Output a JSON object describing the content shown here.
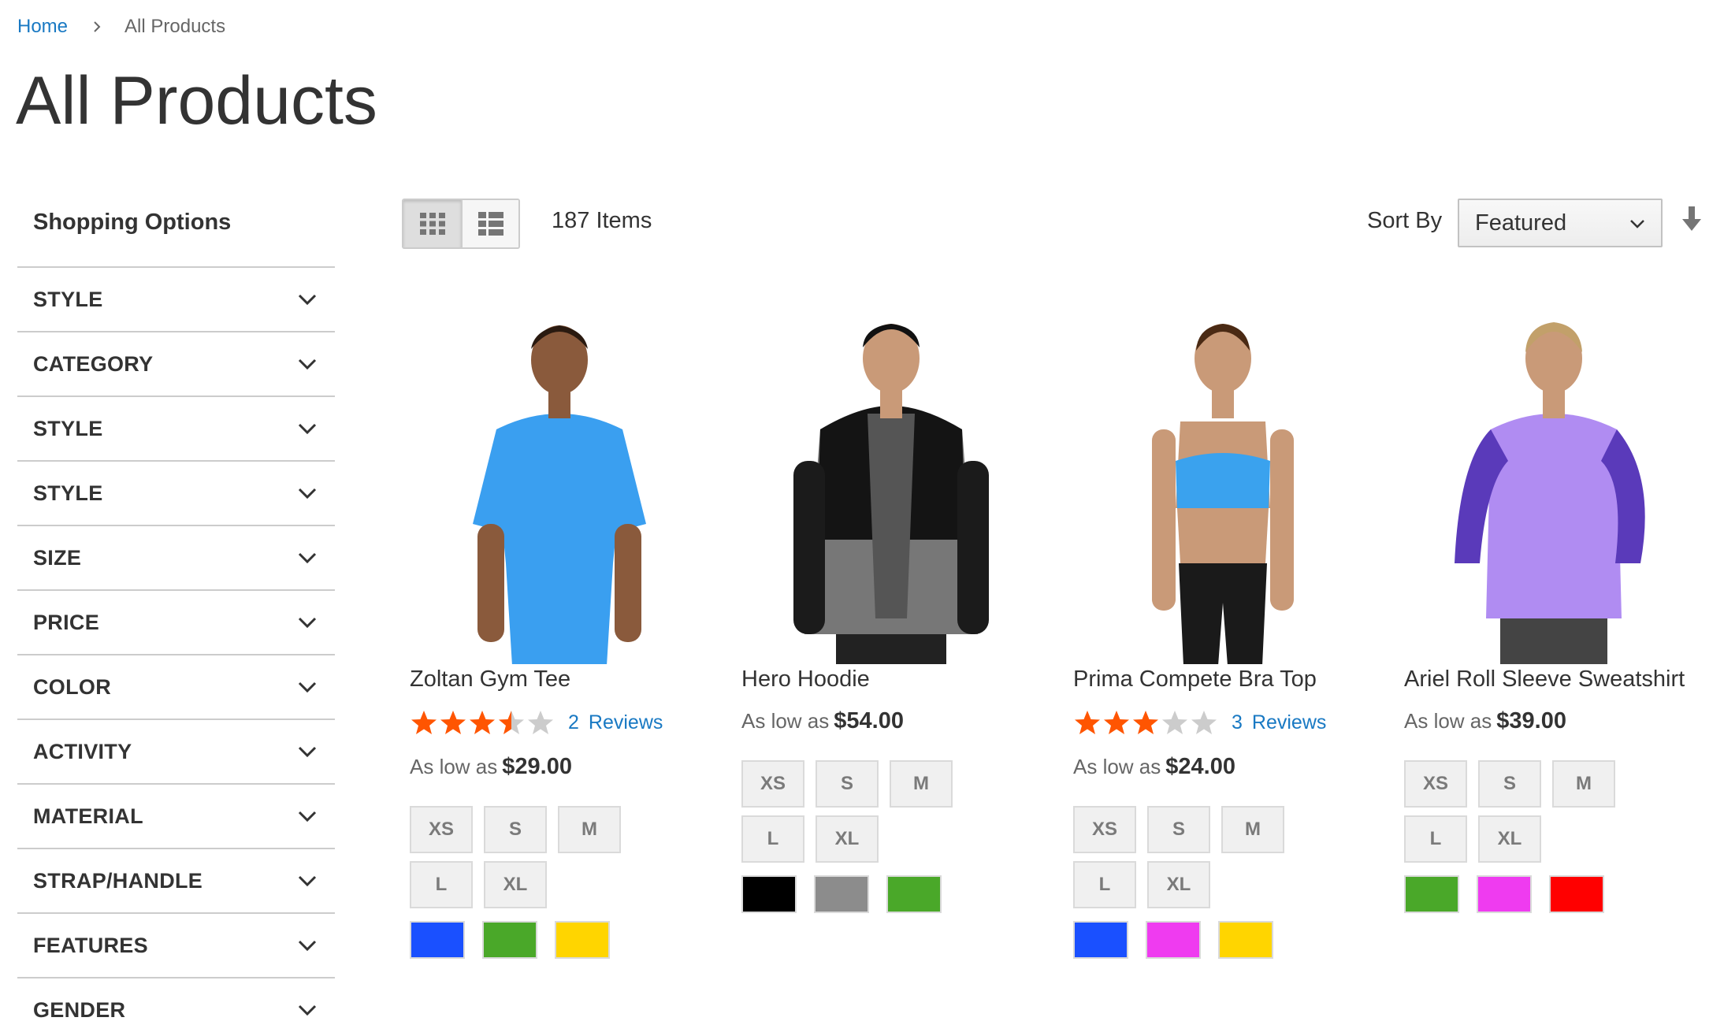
{
  "breadcrumb": {
    "home": "Home",
    "current": "All Products"
  },
  "page": {
    "title": "All Products"
  },
  "sidebar": {
    "title": "Shopping Options",
    "filters": [
      "STYLE",
      "CATEGORY",
      "STYLE",
      "STYLE",
      "SIZE",
      "PRICE",
      "COLOR",
      "ACTIVITY",
      "MATERIAL",
      "STRAP/HANDLE",
      "FEATURES",
      "GENDER"
    ]
  },
  "toolbar": {
    "view_modes": [
      "grid",
      "list"
    ],
    "active_mode": "grid",
    "items_count": "187 Items",
    "sort_label": "Sort By",
    "sort_value": "Featured",
    "sort_direction_icon": "arrow-down-icon"
  },
  "products": [
    {
      "name": "Zoltan Gym Tee",
      "rating": 3.5,
      "review_count": "2",
      "review_label": "Reviews",
      "price_prefix": "As low as",
      "price": "$29.00",
      "sizes": [
        "XS",
        "S",
        "M",
        "L",
        "XL"
      ],
      "colors": [
        "#1a50ff",
        "#4aa829",
        "#ffd500"
      ],
      "image_icon": "model-blue-tee"
    },
    {
      "name": "Hero Hoodie",
      "price_prefix": "As low as",
      "price": "$54.00",
      "sizes": [
        "XS",
        "S",
        "M",
        "L",
        "XL"
      ],
      "colors": [
        "#000000",
        "#8c8c8c",
        "#4aa829"
      ],
      "image_icon": "model-gray-hoodie"
    },
    {
      "name": "Prima Compete Bra Top",
      "rating": 3,
      "review_count": "3",
      "review_label": "Reviews",
      "price_prefix": "As low as",
      "price": "$24.00",
      "sizes": [
        "XS",
        "S",
        "M",
        "L",
        "XL"
      ],
      "colors": [
        "#1a50ff",
        "#ef3bf0",
        "#ffd500"
      ],
      "image_icon": "model-blue-bra-top"
    },
    {
      "name": "Ariel Roll Sleeve Sweatshirt",
      "price_prefix": "As low as",
      "price": "$39.00",
      "sizes": [
        "XS",
        "S",
        "M",
        "L",
        "XL"
      ],
      "colors": [
        "#4aa829",
        "#ef3bf0",
        "#ff0000"
      ],
      "image_icon": "model-purple-sweatshirt"
    }
  ],
  "colors": {
    "link": "#1979c3",
    "star": "#ff5501",
    "star_empty": "#cccccc"
  }
}
